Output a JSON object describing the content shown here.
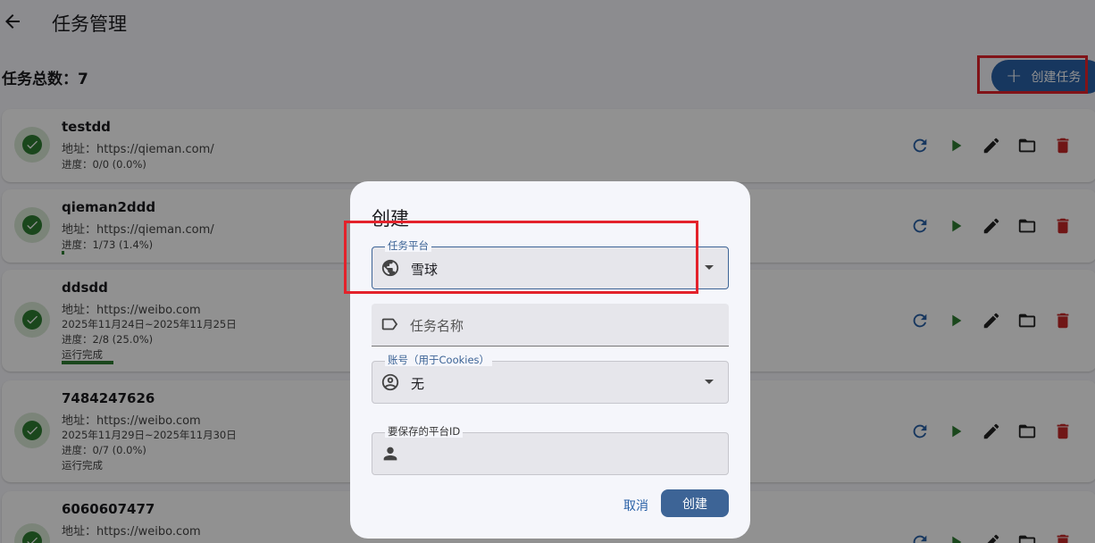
{
  "app": {
    "title": "任务管理",
    "summary_label": "任务总数：7",
    "create_button_label": "创建任务"
  },
  "tasks": [
    {
      "name": "testdd",
      "address": "地址：https://qieman.com/",
      "date_range": "",
      "progress": "进度：0/0 (0.0%)",
      "progress_fraction": 0.0,
      "status": ""
    },
    {
      "name": "qieman2ddd",
      "address": "地址：https://qieman.com/",
      "date_range": "",
      "progress": "进度：1/73 (1.4%)",
      "progress_fraction": 0.014,
      "status": ""
    },
    {
      "name": "ddsdd",
      "address": "地址：https://weibo.com",
      "date_range": "2025年11月24日~2025年11月25日",
      "progress": "进度：2/8 (25.0%)",
      "progress_fraction": 0.25,
      "status": "运行完成"
    },
    {
      "name": "7484247626",
      "address": "地址：https://weibo.com",
      "date_range": "2025年11月29日~2025年11月30日",
      "progress": "进度：0/7 (0.0%)",
      "progress_fraction": 0.0,
      "status": "运行完成"
    },
    {
      "name": "6060607477",
      "address": "地址：https://weibo.com",
      "date_range": "",
      "progress": "",
      "progress_fraction": 0.0,
      "status": ""
    }
  ],
  "dialog": {
    "title": "创建",
    "platform": {
      "label": "任务平台",
      "value": "雪球"
    },
    "task_name": {
      "placeholder": "任务名称"
    },
    "account": {
      "label": "账号（用于Cookies）",
      "value": "无"
    },
    "platform_id": {
      "label": "要保存的平台ID"
    },
    "cancel_label": "取消",
    "confirm_label": "创建"
  },
  "colors": {
    "primary": "#2a61a7",
    "success": "#2e7d32",
    "delete": "#c62828",
    "highlight": "#e3222b"
  },
  "icons": [
    "back-arrow-icon",
    "plus-icon",
    "check-circle-icon",
    "refresh-icon",
    "play-icon",
    "edit-icon",
    "folder-icon",
    "delete-icon",
    "globe-icon",
    "label-icon",
    "account-circle-icon",
    "person-icon",
    "dropdown-arrow-icon"
  ]
}
